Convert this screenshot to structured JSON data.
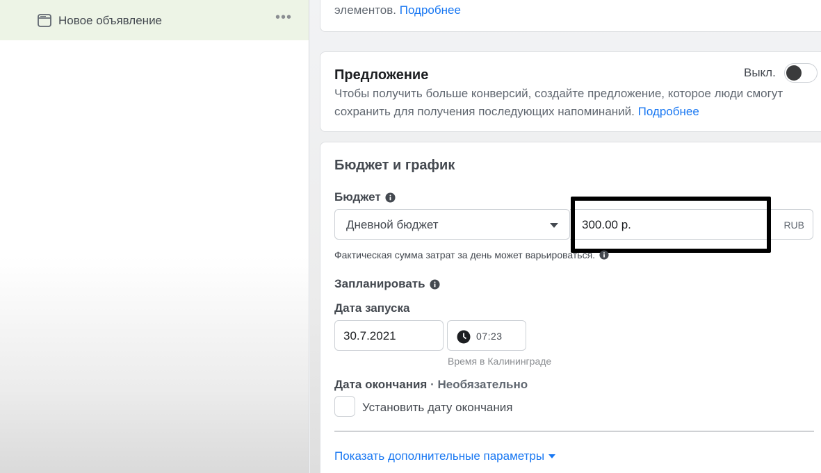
{
  "sidebar": {
    "ad_item": {
      "label": "Новое объявление",
      "icon": "ad-window-icon",
      "more_icon": "•••"
    }
  },
  "top_card": {
    "text": "элементов.",
    "link": "Подробнее"
  },
  "offer": {
    "title": "Предложение",
    "description": "Чтобы получить больше конверсий, создайте предложение, которое люди смогут сохранить для получения последующих напоминаний.",
    "link": "Подробнее",
    "toggle_label": "Выкл.",
    "toggle_on": false
  },
  "budget_schedule": {
    "title": "Бюджет и график",
    "budget_label": "Бюджет",
    "budget_type": "Дневной бюджет",
    "amount": "300.00 р.",
    "currency": "RUB",
    "hint": "Фактическая сумма затрат за день может варьироваться.",
    "schedule_label": "Запланировать",
    "start_label": "Дата запуска",
    "start_date": "30.7.2021",
    "start_time": "07:23",
    "timezone": "Время в Калининграде",
    "end_label": "Дата окончания",
    "end_optional": "· Необязательно",
    "end_checkbox_label": "Установить дату окончания",
    "end_checked": false,
    "more_params": "Показать дополнительные параметры"
  },
  "colors": {
    "link": "#1877f2",
    "highlight": "#000000",
    "sidebar_active": "#edf4e6"
  }
}
